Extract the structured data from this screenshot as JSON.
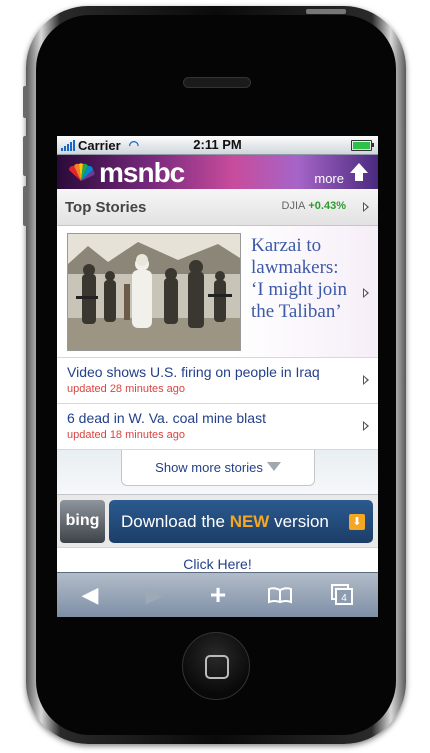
{
  "status": {
    "carrier": "Carrier",
    "time": "2:11 PM"
  },
  "brand": {
    "name": "msnbc",
    "more_label": "more"
  },
  "top_stories": {
    "title": "Top Stories",
    "index_name": "DJIA",
    "index_change": "+0.43%"
  },
  "hero": {
    "headline": "Karzai to lawmakers: ‘I might join the Taliban’"
  },
  "stories": [
    {
      "title": "Video shows U.S. firing on people in Iraq",
      "updated": "updated 28 minutes ago"
    },
    {
      "title": "6 dead in W. Va. coal mine blast",
      "updated": "updated 18 minutes ago"
    }
  ],
  "show_more": "Show more stories",
  "download": {
    "bing_label": "bing",
    "text_before": "Download the ",
    "text_new": "NEW",
    "text_after": " version"
  },
  "click_here": "Click Here!",
  "toolbar": {
    "tabs_count": "4"
  },
  "colors": {
    "accent": "#23418a",
    "timestamp": "#d9443f",
    "positive": "#2e9b2e",
    "new_badge": "#f5a623"
  }
}
